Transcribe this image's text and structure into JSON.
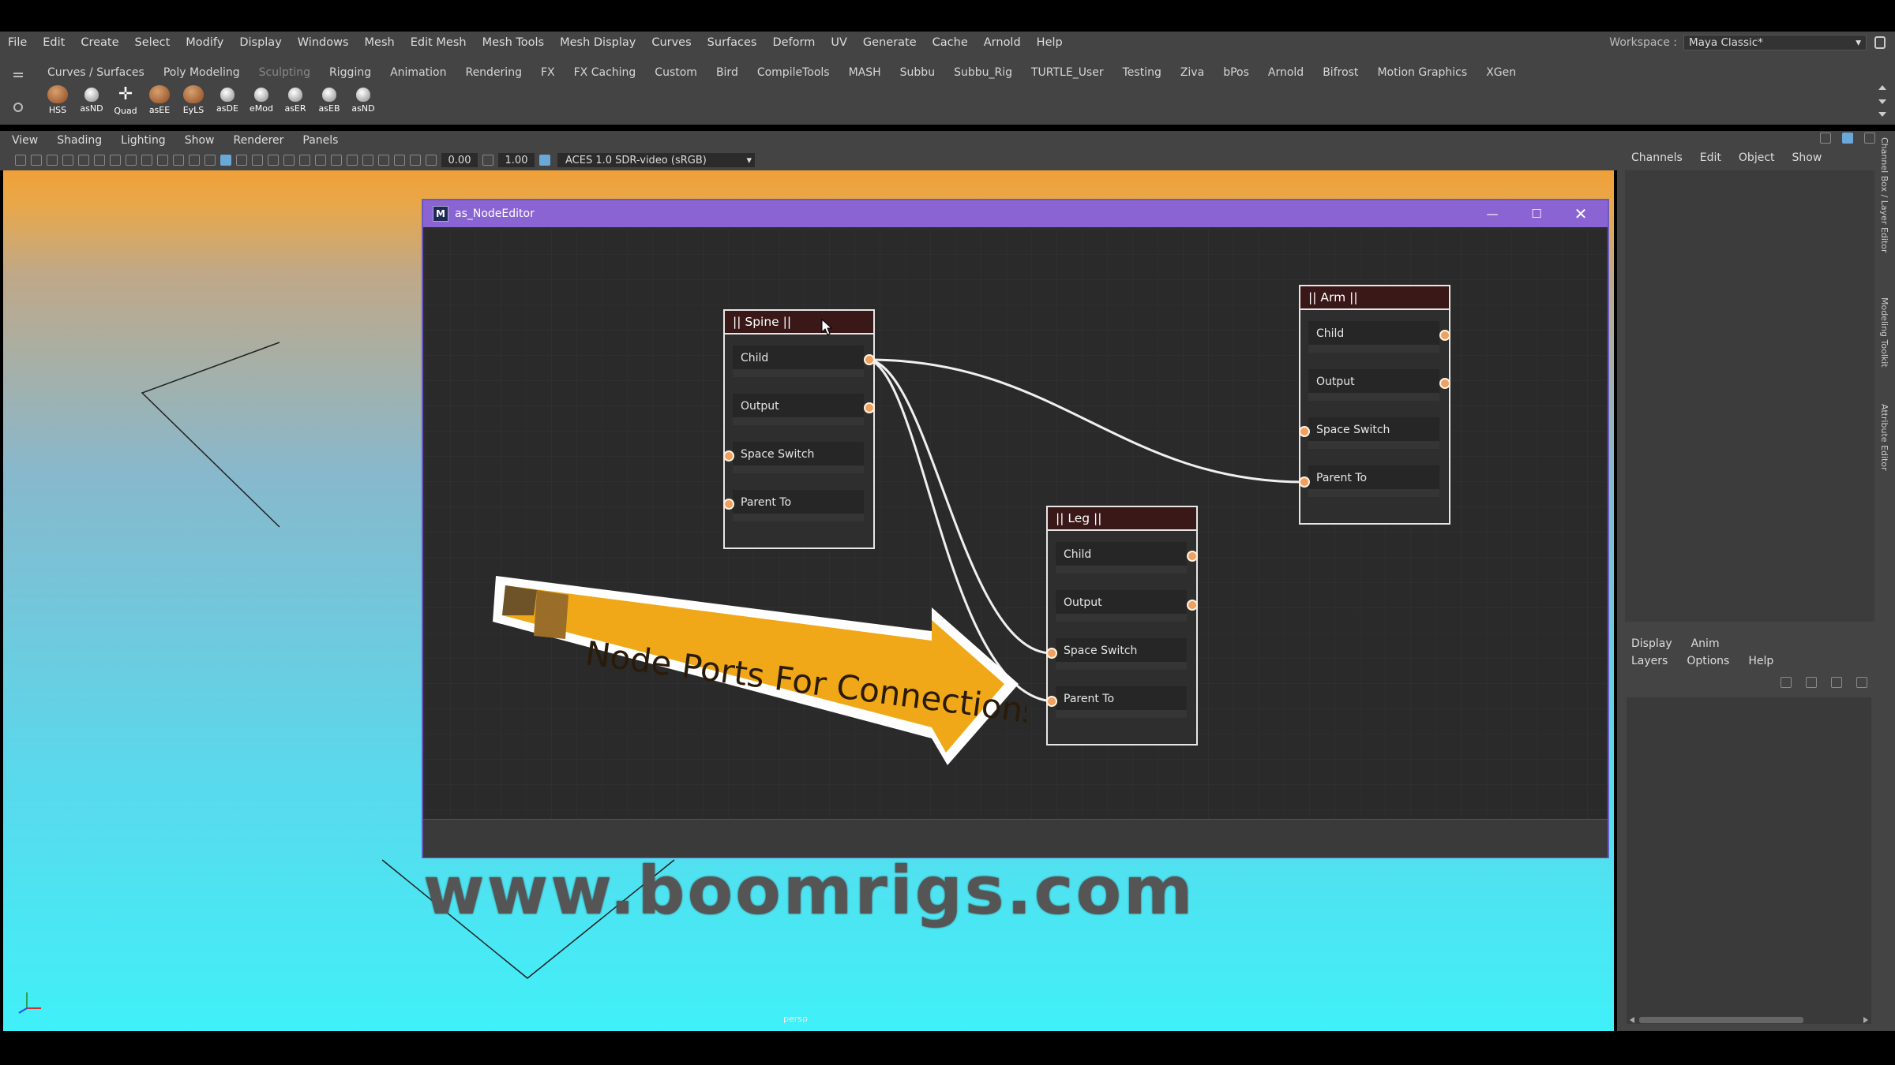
{
  "menubar": {
    "items": [
      "File",
      "Edit",
      "Create",
      "Select",
      "Modify",
      "Display",
      "Windows",
      "Mesh",
      "Edit Mesh",
      "Mesh Tools",
      "Mesh Display",
      "Curves",
      "Surfaces",
      "Deform",
      "UV",
      "Generate",
      "Cache",
      "Arnold",
      "Help"
    ],
    "workspace_label": "Workspace :",
    "workspace_value": "Maya Classic*"
  },
  "shelf": {
    "tabs": [
      "Curves / Surfaces",
      "Poly Modeling",
      "Sculpting",
      "Rigging",
      "Animation",
      "Rendering",
      "FX",
      "FX Caching",
      "Custom",
      "Bird",
      "CompileTools",
      "MASH",
      "Subbu",
      "Subbu_Rig",
      "TURTLE_User",
      "Testing",
      "Ziva",
      "bPos",
      "Arnold",
      "Bifrost",
      "Motion Graphics",
      "XGen"
    ],
    "icons": [
      "HSS",
      "asND",
      "Quad",
      "asEE",
      "EyLS",
      "asDE",
      "eMod",
      "asER",
      "asEB",
      "asND"
    ]
  },
  "viewport": {
    "menu": [
      "View",
      "Shading",
      "Lighting",
      "Show",
      "Renderer",
      "Panels"
    ],
    "field1": "0.00",
    "field2": "1.00",
    "colorspace": "ACES 1.0 SDR-video (sRGB)",
    "camera": "persp"
  },
  "channelbox": {
    "menu": [
      "Channels",
      "Edit",
      "Object",
      "Show"
    ],
    "side_tabs": [
      "Channel Box / Layer Editor",
      "Modeling Toolkit",
      "Attribute Editor"
    ]
  },
  "layer_editor": {
    "tabs": [
      "Display",
      "Anim"
    ],
    "menu": [
      "Layers",
      "Options",
      "Help"
    ]
  },
  "node_editor": {
    "title": "as_NodeEditor",
    "nodes": [
      {
        "name": "|| Spine ||",
        "ports": [
          "Child",
          "Output",
          "Space Switch",
          "Parent To"
        ]
      },
      {
        "name": "|| Arm ||",
        "ports": [
          "Child",
          "Output",
          "Space Switch",
          "Parent To"
        ]
      },
      {
        "name": "|| Leg ||",
        "ports": [
          "Child",
          "Output",
          "Space Switch",
          "Parent To"
        ]
      }
    ],
    "connections": [
      {
        "from": "|| Spine || Child",
        "to": "|| Arm || Parent To"
      },
      {
        "from": "|| Spine || Child",
        "to": "|| Leg || Space Switch"
      },
      {
        "from": "|| Spine || Child",
        "to": "|| Leg || Parent To"
      }
    ],
    "annotation": "Node Ports For Connections"
  },
  "watermark": "www.boomrigs.com",
  "colors": {
    "title_bar": "#8a64d2",
    "port": "#f0a060",
    "banner": "#f0a818",
    "node_header": "#3a1818"
  }
}
